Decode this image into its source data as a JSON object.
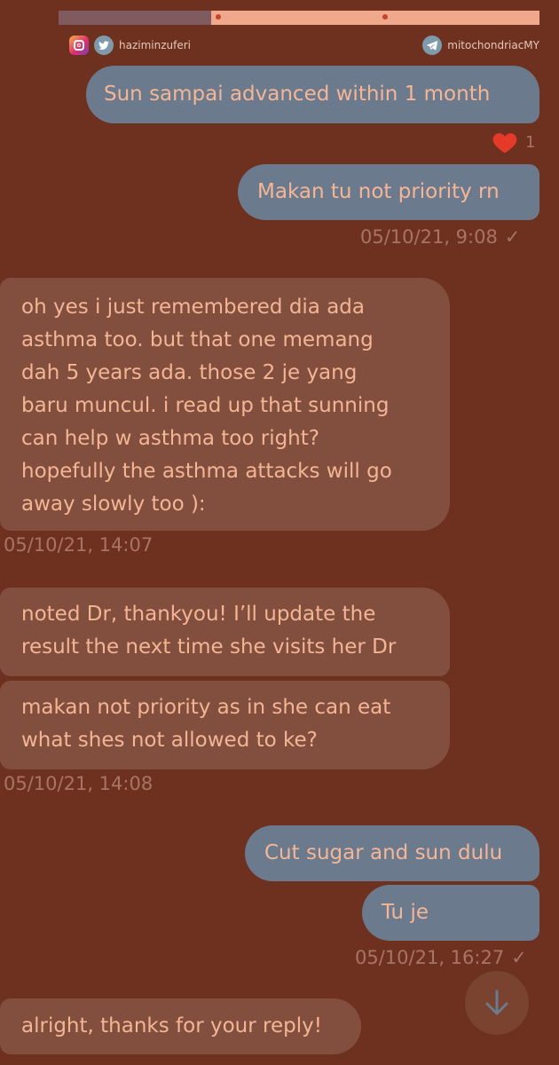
{
  "credits": {
    "left_handle": "haziminzuferi",
    "right_handle": "mitochondriacMY",
    "left_icons": [
      "instagram-icon",
      "twitter-icon"
    ],
    "right_icon": "telegram-icon"
  },
  "messages": {
    "m1": {
      "text": "Sun sampai advanced within 1 month"
    },
    "m1_reaction": {
      "icon": "heart-icon",
      "count": "1"
    },
    "m2": {
      "text": "Makan tu not priority rn",
      "timestamp": "05/10/21, 9:08"
    },
    "m3": {
      "lines": [
        "oh yes i just remembered dia ada",
        "asthma too. but that one memang",
        "dah 5 years ada. those 2 je yang",
        "baru muncul. i read up that sunning",
        "can help w asthma too right?",
        "hopefully the asthma attacks will go",
        "away slowly too ):"
      ],
      "timestamp": "05/10/21, 14:07"
    },
    "m4": {
      "lines": [
        "noted Dr, thankyou! I’ll update the",
        "result the next time she visits her Dr"
      ]
    },
    "m5": {
      "lines": [
        "makan not priority as in she can eat",
        "what shes not allowed to ke?"
      ],
      "timestamp": "05/10/21, 14:08"
    },
    "m6": {
      "text": "Cut sugar and sun dulu"
    },
    "m7": {
      "text": "Tu je",
      "timestamp": "05/10/21, 16:27"
    },
    "m8": {
      "text": "alright, thanks for your reply!"
    }
  },
  "colors": {
    "background": "#6e311f",
    "outgoing_bubble": "#6b7a8d",
    "incoming_bubble": "#824f3f",
    "text": "#f3b594",
    "meta": "#a87464",
    "heart": "#e53a2a"
  }
}
